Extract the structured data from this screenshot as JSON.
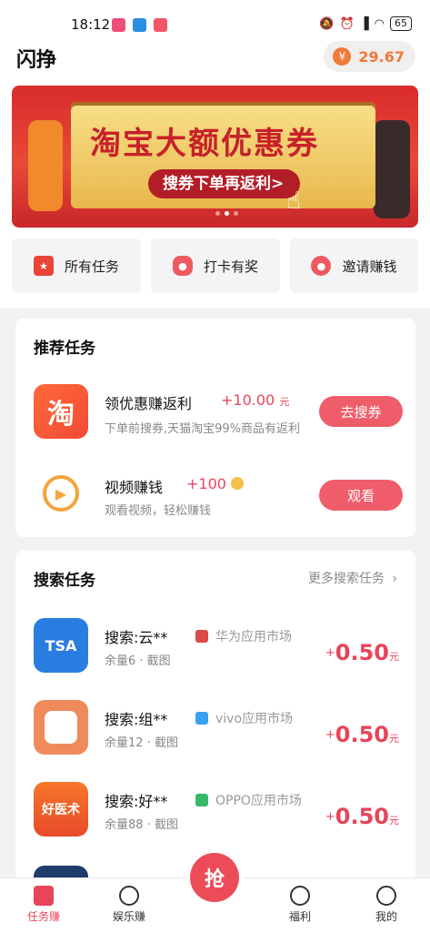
{
  "status_bar": {
    "time": "18:12",
    "battery": "65"
  },
  "header": {
    "app_title": "闪挣",
    "balance_symbol": "¥",
    "balance": "29.67"
  },
  "banner": {
    "headline": "淘宝大额优惠券",
    "subline": "搜券下单再返利>",
    "page_count": 3,
    "active_page": 2
  },
  "quick_actions": [
    {
      "label": "所有任务",
      "icon": "star-flag-icon"
    },
    {
      "label": "打卡有奖",
      "icon": "gamepad-icon"
    },
    {
      "label": "邀请赚钱",
      "icon": "invite-user-icon"
    }
  ],
  "recommended": {
    "title": "推荐任务",
    "items": [
      {
        "title": "领优惠赚返利",
        "reward": "+10.00",
        "reward_unit": "元",
        "desc": "下单前搜券,天猫淘宝99%商品有返利",
        "button": "去搜券",
        "icon_text": "淘"
      },
      {
        "title": "视频赚钱",
        "reward": "+100",
        "reward_unit": "",
        "desc": "观看视频，轻松赚钱",
        "button": "观看",
        "icon_text": ""
      }
    ]
  },
  "search_tasks": {
    "title": "搜索任务",
    "more": "更多搜索任务",
    "items": [
      {
        "title": "搜索:云**",
        "market": "华为应用市场",
        "meta": "余量6 · 截图",
        "price_prefix": "+",
        "price": "0.50",
        "price_unit": "元",
        "icon_text": "TSA"
      },
      {
        "title": "搜索:组**",
        "market": "vivo应用市场",
        "meta": "余量12 · 截图",
        "price_prefix": "+",
        "price": "0.50",
        "price_unit": "元",
        "icon_text": ""
      },
      {
        "title": "搜索:好**",
        "market": "OPPO应用市场",
        "meta": "余量88 · 截图",
        "price_prefix": "+",
        "price": "0.50",
        "price_unit": "元",
        "icon_text": "好医术"
      }
    ]
  },
  "tabbar": {
    "tabs": [
      {
        "label": "任务赚",
        "active": true
      },
      {
        "label": "娱乐赚",
        "active": false
      },
      {
        "label": "福利",
        "active": false
      },
      {
        "label": "我的",
        "active": false
      }
    ],
    "center_button": "抢"
  },
  "colors": {
    "accent": "#e8445a",
    "button": "#ef5d6a",
    "balance": "#f07a3a"
  }
}
